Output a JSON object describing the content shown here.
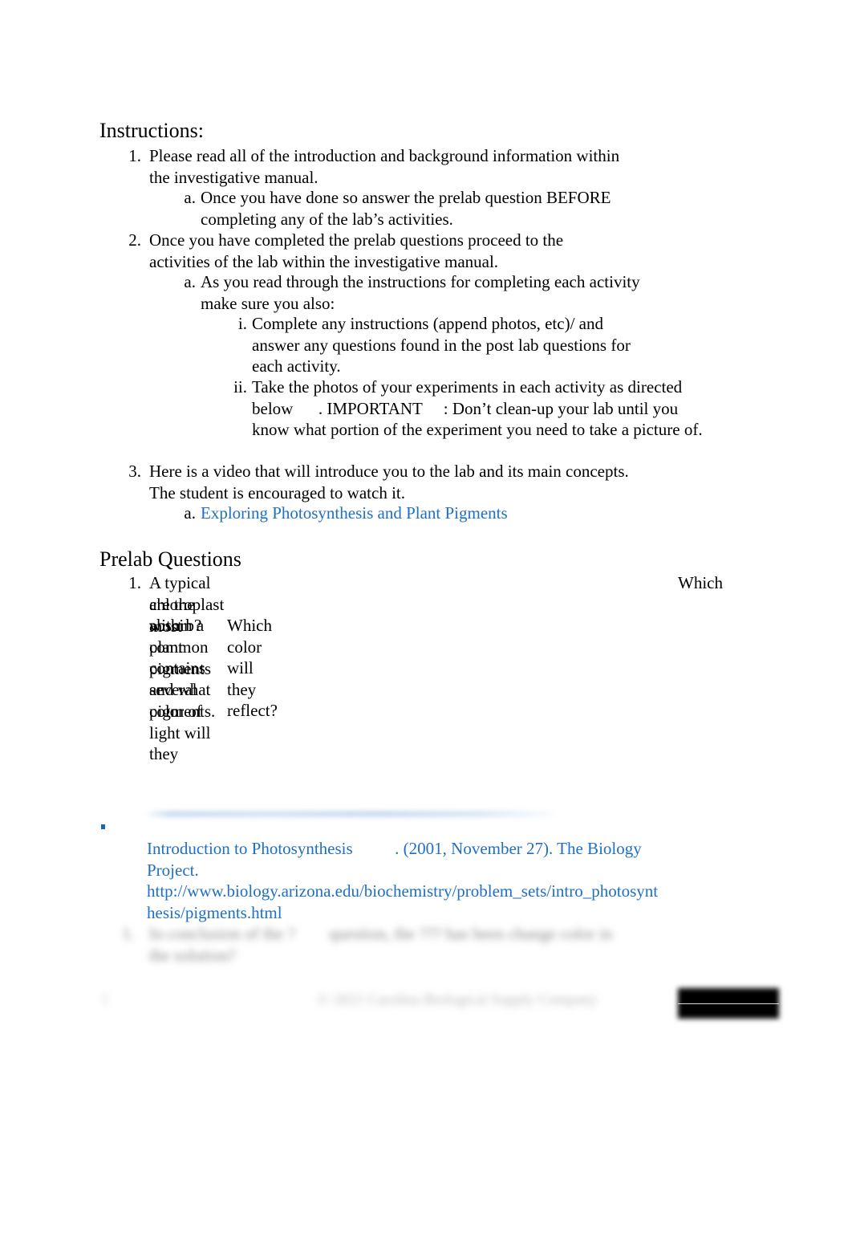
{
  "document": {
    "sections": {
      "instructions_heading": "Instructions:",
      "prelab_heading": "Prelab Questions"
    },
    "instructions": [
      {
        "marker": "1.",
        "text": "Please read all of the introduction and background information within the investigative manual.",
        "children": [
          {
            "marker": "a.",
            "text": "Once you have done so answer the prelab question BEFORE completing any of the lab’s activities."
          }
        ]
      },
      {
        "marker": "2.",
        "text": "Once you have completed the prelab questions proceed to the activities of the lab within the investigative manual.",
        "children": [
          {
            "marker": "a.",
            "text": "As you read through the instructions for completing each activity make sure you also:",
            "children": [
              {
                "marker": "i.",
                "text": "Complete any instructions (append photos, etc)/ and answer any questions found in the post lab questions for each activity."
              },
              {
                "marker": "ii.",
                "text": "Take the photos of your experiments in each activity as directed below      . IMPORTANT     : Don’t clean-up your lab until you know what portion of the experiment you need to take a picture of."
              }
            ]
          }
        ]
      },
      {
        "marker": "3.",
        "text": "Here is a video that will introduce you to the lab and its main concepts. The student is encouraged to watch it.",
        "children": [
          {
            "marker": "a.",
            "link_text": "Exploring Photosynthesis and Plant Pigments"
          }
        ]
      }
    ],
    "prelab_questions": [
      {
        "marker": "1.",
        "line1": "A typical chloroplast within a plant contains several pigments.",
        "line1_tail": "Which",
        "line2": "are the most common pigments and what color of light will they",
        "line3_a": "absorb?",
        "line3_b": "Which color will they reflect?"
      }
    ],
    "citation": {
      "title": "Introduction to Photosynthesis",
      "spacer": "          ",
      "rest": ". (2001, November 27). The Biology Project. http://www.biology.arizona.edu/biochemistry/problem_sets/intro_photosynthesis/pigments.html"
    },
    "obscured": {
      "list_marker": "1.",
      "line1": "In conclusion of the ?        question, the ??? has been change color in",
      "line2": "the solution?",
      "footer_center": "© 2021 Carolina Biological Supply Company",
      "page_number": "1"
    },
    "colors": {
      "hyperlink": "#1F6FC4",
      "body_text": "#000000",
      "page_background": "#ffffff",
      "redaction": "#000000"
    }
  }
}
